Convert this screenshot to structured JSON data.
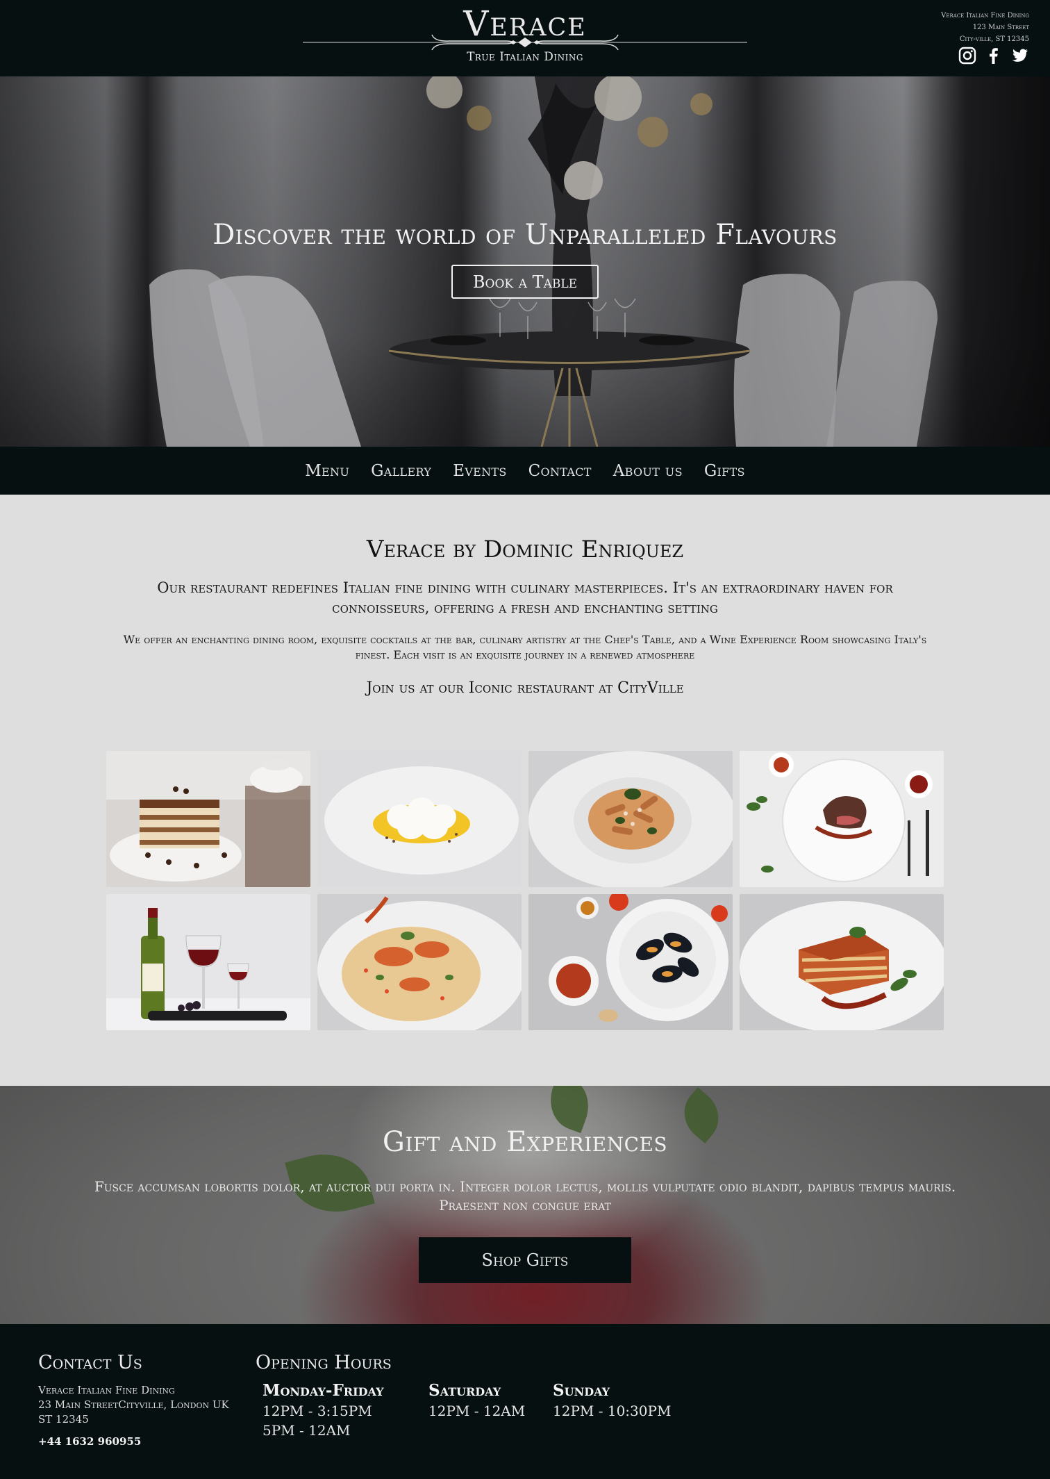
{
  "header": {
    "brand": "Verace",
    "tagline": "True Italian Dining",
    "address_lines": [
      "Verace Italian Fine Dining",
      "123 Main Street",
      "City-ville, ST 12345"
    ],
    "social_icons": [
      "instagram-icon",
      "facebook-icon",
      "twitter-icon"
    ]
  },
  "hero": {
    "headline": "Discover the world of Unparalleled Flavours",
    "cta_label": "Book a Table"
  },
  "nav": {
    "items": [
      "Menu",
      "Gallery",
      "Events",
      "Contact",
      "About us",
      "Gifts"
    ]
  },
  "about": {
    "title": "Verace by Dominic Enriquez",
    "lead": "Our restaurant redefines Italian fine dining with culinary masterpieces. It's an extraordinary haven for connoisseurs, offering a fresh and enchanting setting",
    "body": "We offer an enchanting dining room, exquisite cocktails at the bar, culinary artistry at the Chef's Table, and a Wine Experience Room showcasing Italy's finest. Each visit is an exquisite journey in a renewed atmosphere",
    "join": "Join us at our Iconic restaurant at CityVille"
  },
  "gallery": {
    "images": [
      "tiramisu",
      "meringue-dessert",
      "penne-pasta",
      "steak-plate",
      "red-wine",
      "lobster-risotto",
      "mussels-plate",
      "lasagna"
    ]
  },
  "gifts": {
    "title": "Gift and Experiences",
    "text": "Fusce accumsan lobortis dolor, at auctor dui porta in. Integer dolor lectus, mollis vulputate odio blandit, dapibus tempus mauris. Praesent non congue erat",
    "cta_label": "Shop Gifts"
  },
  "footer": {
    "contact_title": "Contact Us",
    "contact_lines": [
      "Verace Italian Fine Dining",
      "23 Main StreetCityville, London UK",
      "ST 12345"
    ],
    "phone": "+44 1632 960955",
    "hours_title": "Opening Hours",
    "days": [
      {
        "name": "Monday-Friday",
        "lines": [
          "12PM - 3:15PM",
          "5PM - 12AM"
        ]
      },
      {
        "name": "Saturday",
        "lines": [
          "12PM - 12AM"
        ]
      },
      {
        "name": "Sunday",
        "lines": [
          "12PM - 10:30PM"
        ]
      }
    ]
  },
  "colors": {
    "dark_bg": "#071011",
    "page_bg": "#dedede",
    "light_text": "#f2f2f2"
  }
}
